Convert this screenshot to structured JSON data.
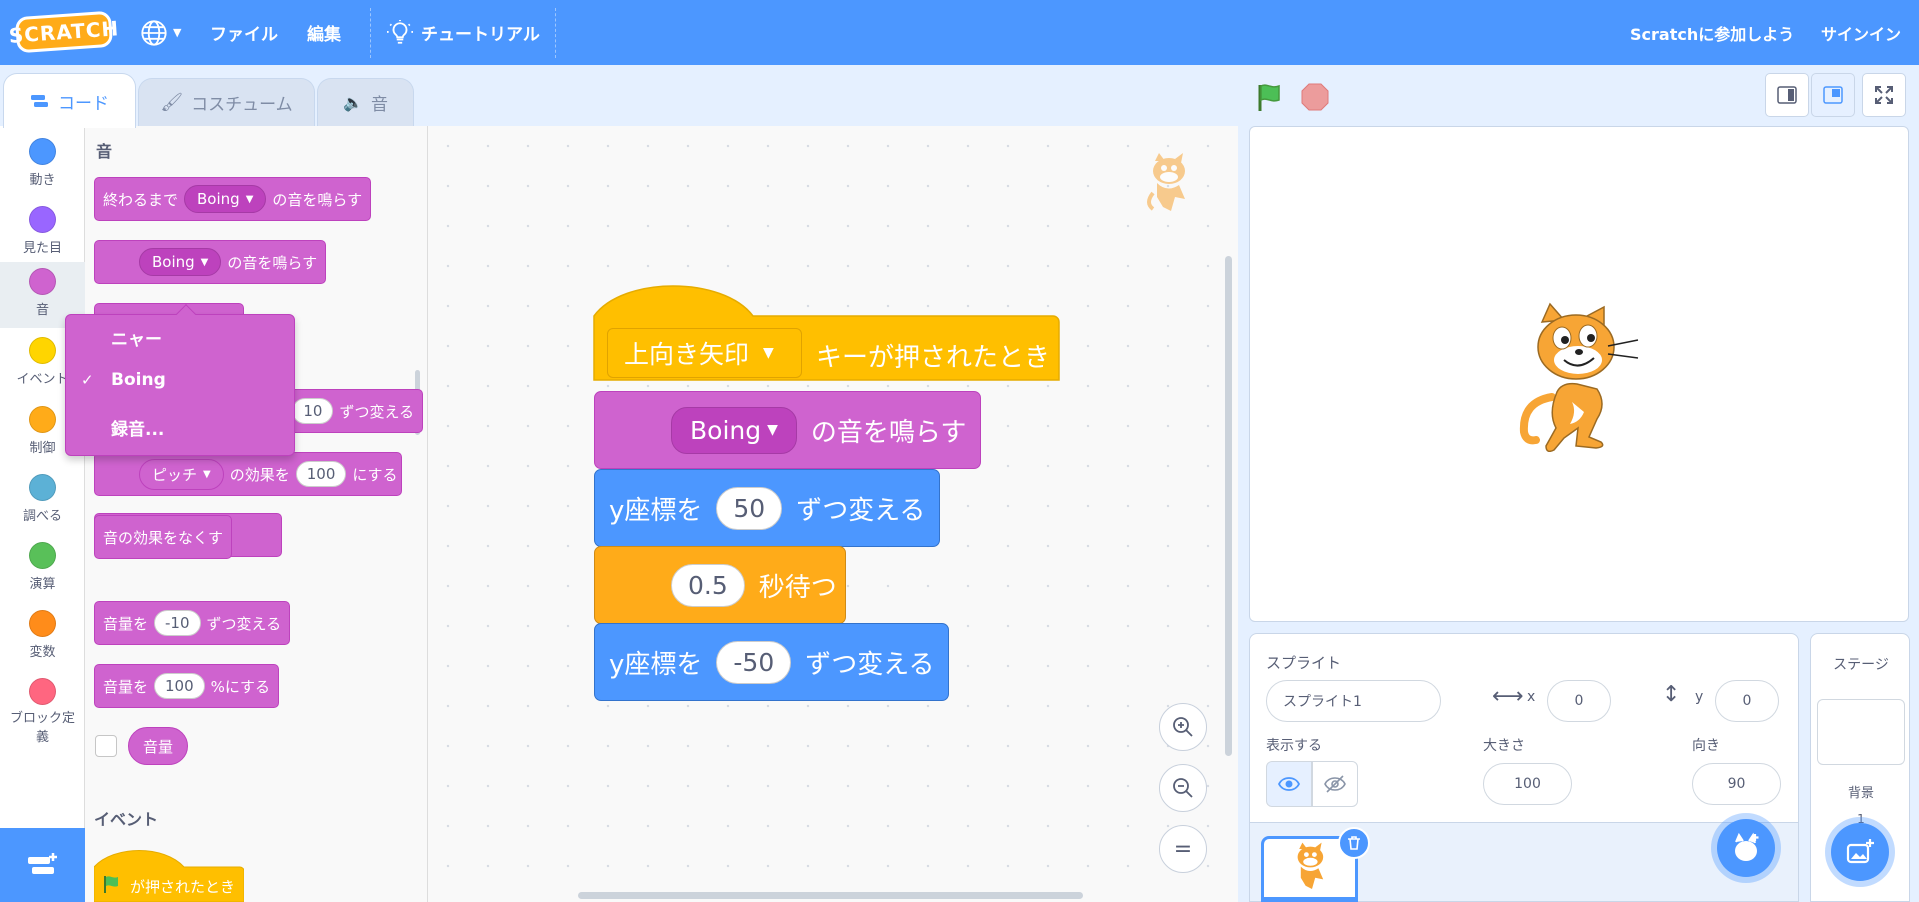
{
  "menubar": {
    "logo": "SCRATCH",
    "file": "ファイル",
    "edit": "編集",
    "tutorials": "チュートリアル",
    "join": "Scratchに参加しよう",
    "signin": "サインイン"
  },
  "tabs": {
    "code": "コード",
    "costumes": "コスチューム",
    "sounds": "音"
  },
  "categories": [
    {
      "label": "動き",
      "color": "#4c97ff"
    },
    {
      "label": "見た目",
      "color": "#9966ff"
    },
    {
      "label": "音",
      "color": "#cf63cf"
    },
    {
      "label": "イベント",
      "color": "#ffd500"
    },
    {
      "label": "制御",
      "color": "#ffab19"
    },
    {
      "label": "調べる",
      "color": "#5cb1d6"
    },
    {
      "label": "演算",
      "color": "#59c059"
    },
    {
      "label": "変数",
      "color": "#ff8c1a"
    },
    {
      "label": "ブロック定義",
      "color": "#ff6680"
    }
  ],
  "palette": {
    "heading_sound": "音",
    "play_until_done_pre": "終わるまで",
    "play_until_done_sound": "Boing",
    "play_until_done_post": "の音を鳴らす",
    "start_sound_sound": "Boing",
    "start_sound_post": "の音を鳴らす",
    "change_effect_value": "10",
    "change_effect_post": "ずつ変える",
    "set_effect_name": "ピッチ",
    "set_effect_mid": "の効果を",
    "set_effect_value": "100",
    "set_effect_post": "にする",
    "clear_effects": "音の効果をなくす",
    "change_volume_pre": "音量を",
    "change_volume_value": "-10",
    "change_volume_post": "ずつ変える",
    "set_volume_pre": "音量を",
    "set_volume_value": "100",
    "set_volume_post": "%にする",
    "volume_reporter": "音量",
    "heading_events": "イベント",
    "flag_hat": "が押されたとき"
  },
  "dropdown": {
    "items": [
      "ニャー",
      "Boing",
      "録音..."
    ],
    "selected_mark": "✓"
  },
  "script": {
    "hat_key": "上向き矢印",
    "hat_text": "キーが押されたとき",
    "sound_name": "Boing",
    "sound_text": "の音を鳴らす",
    "y1_pre": "y座標を",
    "y1_value": "50",
    "y1_post": "ずつ変える",
    "wait_value": "0.5",
    "wait_post": "秒待つ",
    "y2_pre": "y座標を",
    "y2_value": "-50",
    "y2_post": "ずつ変える"
  },
  "zoom": {
    "in": "+",
    "out": "−",
    "reset": "="
  },
  "sprite_info": {
    "sprite_label": "スプライト",
    "sprite_name": "スプライト1",
    "x_label": "x",
    "x_value": "0",
    "y_label": "y",
    "y_value": "0",
    "show_label": "表示する",
    "size_label": "大きさ",
    "size_value": "100",
    "direction_label": "向き",
    "direction_value": "90"
  },
  "stage_pane": {
    "title": "ステージ",
    "backdrop_label": "背景",
    "backdrop_count": "1"
  },
  "colors": {
    "motion": "#4c97ff",
    "sound": "#cf63cf",
    "events": "#ffbf00",
    "control": "#ffab19",
    "menubar": "#4c97ff"
  }
}
